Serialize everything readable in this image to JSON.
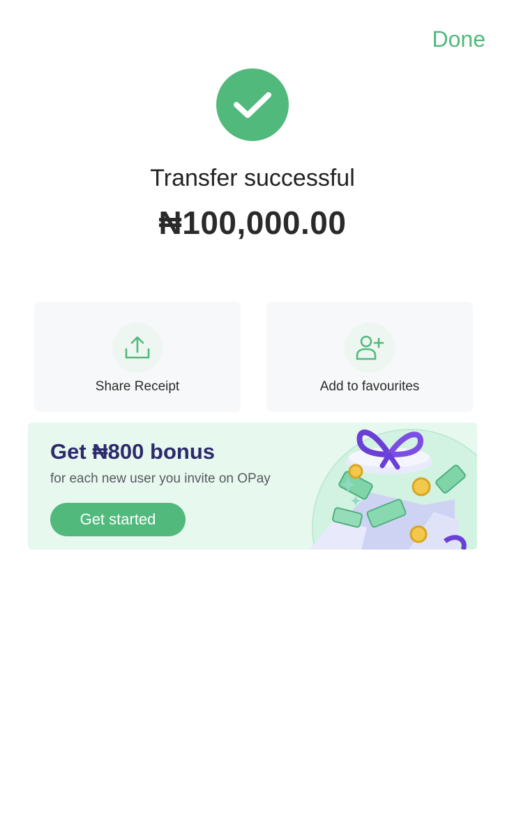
{
  "header": {
    "done_label": "Done"
  },
  "result": {
    "title": "Transfer successful",
    "amount": "₦100,000.00",
    "icon": "checkmark-icon"
  },
  "actions": [
    {
      "label": "Share Receipt",
      "icon": "share-upload-icon"
    },
    {
      "label": "Add to favourites",
      "icon": "add-user-icon"
    }
  ],
  "promo": {
    "title": "Get ₦800 bonus",
    "subtitle": "for each new user you invite on OPay",
    "button_label": "Get started"
  },
  "colors": {
    "accent": "#52b97c",
    "promo_background": "#e7f8ef",
    "promo_title": "#2c2a6b",
    "card_background": "#f7f8f9"
  }
}
